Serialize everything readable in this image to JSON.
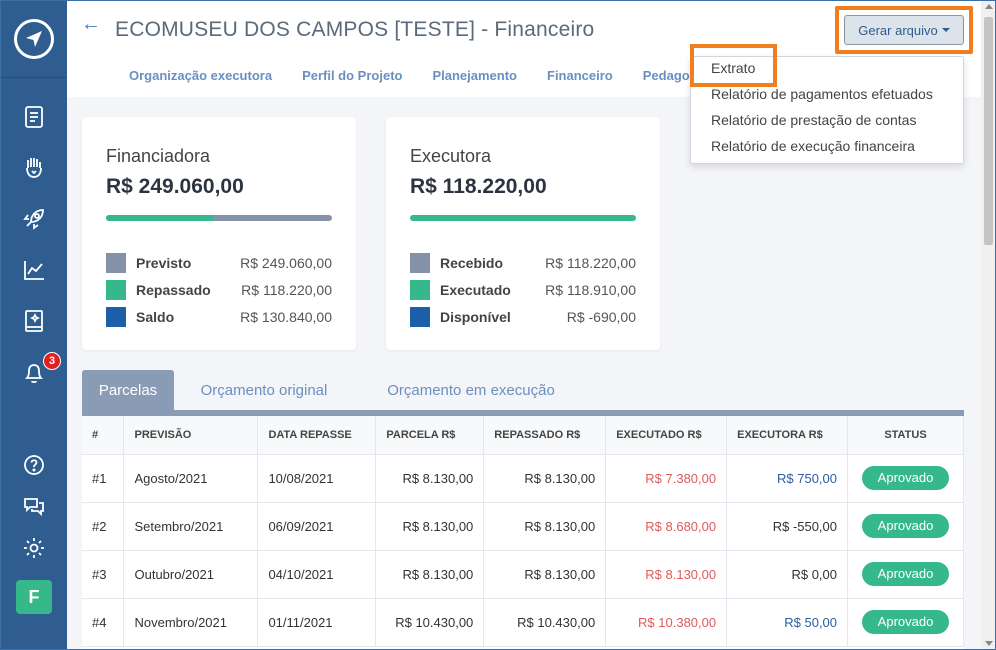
{
  "app": {
    "page_title": "ECOMUSEU DOS CAMPOS [TESTE] - Financeiro",
    "back_icon": "arrow-left-icon"
  },
  "nav": [
    "Organização executora",
    "Perfil do Projeto",
    "Planejamento",
    "Financeiro",
    "Pedago"
  ],
  "generate": {
    "label": "Gerar arquivo",
    "menu": [
      "Extrato",
      "Relatório de pagamentos efetuados",
      "Relatório de prestação de contas",
      "Relatório de execução financeira"
    ]
  },
  "sidebar": {
    "notification_count": "3",
    "user_initial": "F"
  },
  "cards": {
    "financiadora": {
      "title": "Financiadora",
      "value": "R$ 249.060,00",
      "progress": 0.473,
      "legend": [
        {
          "label": "Previsto",
          "value": "R$ 249.060,00",
          "color": "#8592a8"
        },
        {
          "label": "Repassado",
          "value": "R$ 118.220,00",
          "color": "#35b88a"
        },
        {
          "label": "Saldo",
          "value": "R$ 130.840,00",
          "color": "#1a5fa8"
        }
      ]
    },
    "executora": {
      "title": "Executora",
      "value": "R$ 118.220,00",
      "progress": 1.0,
      "legend": [
        {
          "label": "Recebido",
          "value": "R$ 118.220,00",
          "color": "#8592a8"
        },
        {
          "label": "Executado",
          "value": "R$ 118.910,00",
          "color": "#35b88a"
        },
        {
          "label": "Disponível",
          "value": "R$ -690,00",
          "color": "#1a5fa8"
        }
      ]
    }
  },
  "tabs": [
    "Parcelas",
    "Orçamento original",
    "Orçamento em execução"
  ],
  "table": {
    "headers": [
      "#",
      "PREVISÃO",
      "DATA REPASSE",
      "PARCELA R$",
      "REPASSADO R$",
      "EXECUTADO R$",
      "EXECUTORA R$",
      "STATUS"
    ],
    "rows": [
      [
        "#1",
        "Agosto/2021",
        "10/08/2021",
        "R$ 8.130,00",
        "R$ 8.130,00",
        "R$ 7.380,00",
        "R$ 750,00",
        "Aprovado"
      ],
      [
        "#2",
        "Setembro/2021",
        "06/09/2021",
        "R$ 8.130,00",
        "R$ 8.130,00",
        "R$ 8.680,00",
        "R$ -550,00",
        "Aprovado"
      ],
      [
        "#3",
        "Outubro/2021",
        "04/10/2021",
        "R$ 8.130,00",
        "R$ 8.130,00",
        "R$ 8.130,00",
        "R$ 0,00",
        "Aprovado"
      ],
      [
        "#4",
        "Novembro/2021",
        "01/11/2021",
        "R$ 10.430,00",
        "R$ 10.430,00",
        "R$ 10.380,00",
        "R$ 50,00",
        "Aprovado"
      ]
    ]
  }
}
